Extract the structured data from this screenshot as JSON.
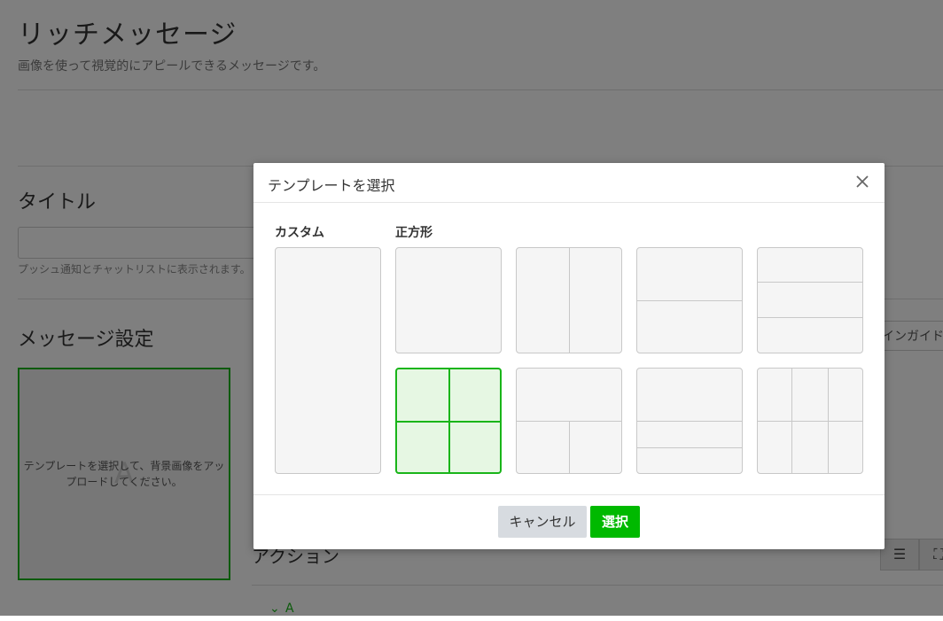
{
  "page": {
    "title": "リッチメッセージ",
    "subtitle": "画像を使って視覚的にアピールできるメッセージです。",
    "title_section": "タイトル",
    "title_hint": "プッシュ通知とチャットリストに表示されます。",
    "message_section": "メッセージ設定",
    "guide_button": "インガイド",
    "preview_letter": "A",
    "preview_text": "テンプレートを選択して、背景画像をアップロードしてください。",
    "action_section": "アクション",
    "accordion_label": "A"
  },
  "modal": {
    "title": "テンプレートを選択",
    "custom_label": "カスタム",
    "square_label": "正方形",
    "selected_template_index": 4,
    "cancel_label": "キャンセル",
    "select_label": "選択"
  },
  "colors": {
    "accent": "#00b900",
    "selected_border": "#19b519",
    "selected_fill": "#e6f7e3"
  }
}
